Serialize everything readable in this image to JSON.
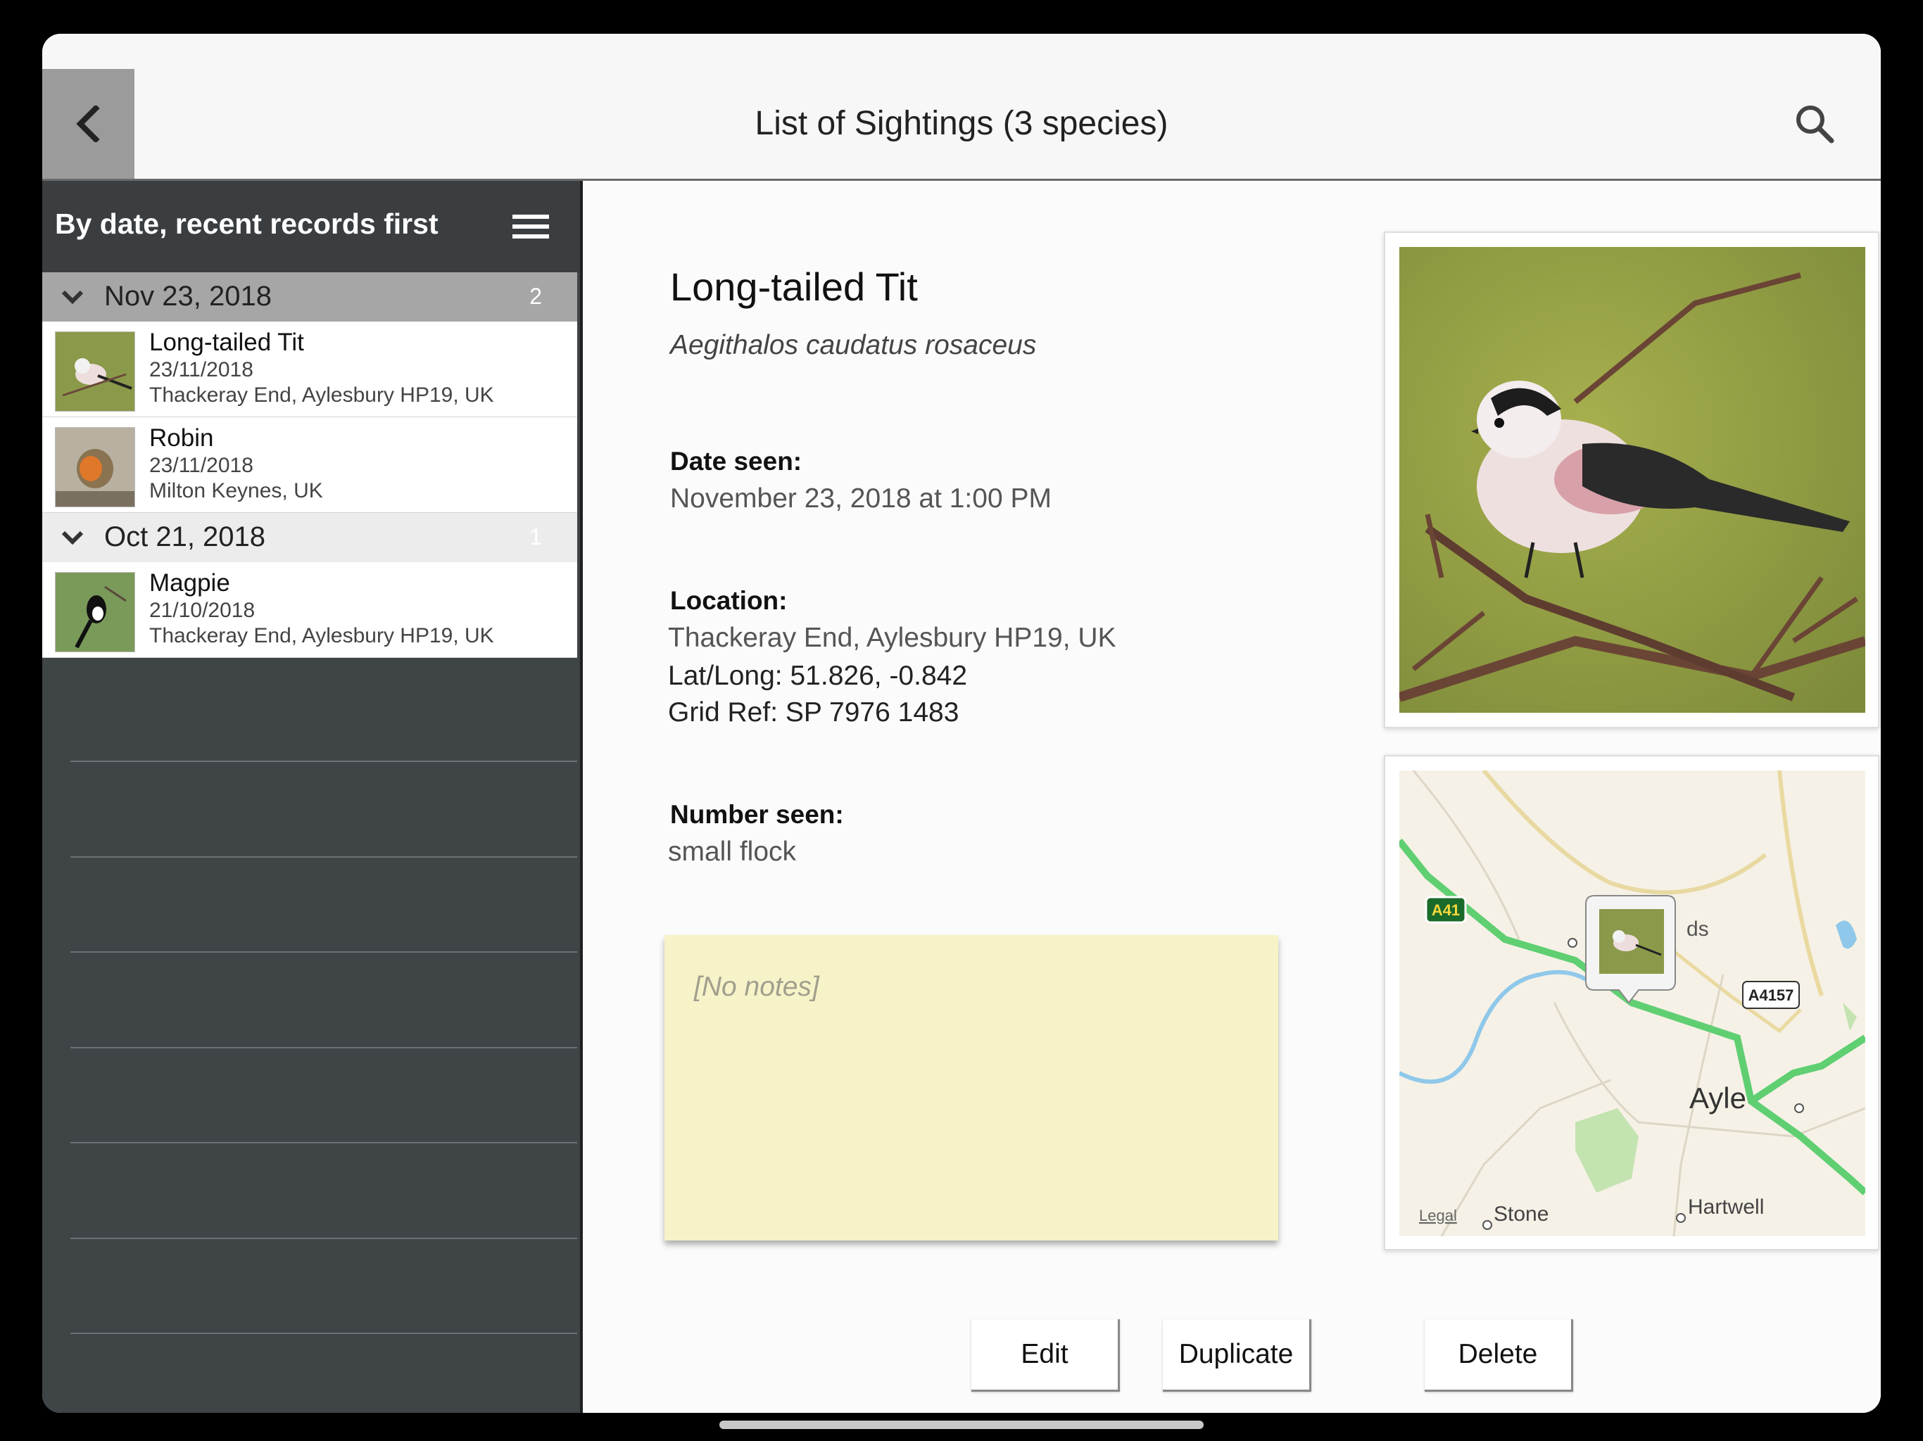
{
  "nav": {
    "title": "List of Sightings (3 species)",
    "back_icon": "chevron-left-icon",
    "search_icon": "search-icon"
  },
  "sidebar": {
    "sort_label": "By date, recent records first",
    "menu_icon": "hamburger-menu-icon",
    "groups": [
      {
        "label": "Nov 23, 2018",
        "count": "2",
        "items": [
          {
            "name": "Long-tailed Tit",
            "date": "23/11/2018",
            "location": "Thackeray End, Aylesbury HP19, UK"
          },
          {
            "name": "Robin",
            "date": "23/11/2018",
            "location": "Milton Keynes, UK"
          }
        ]
      },
      {
        "label": "Oct 21, 2018",
        "count": "1",
        "items": [
          {
            "name": "Magpie",
            "date": "21/10/2018",
            "location": "Thackeray End, Aylesbury HP19, UK"
          }
        ]
      }
    ]
  },
  "detail": {
    "name": "Long-tailed Tit",
    "latin": "Aegithalos caudatus rosaceus",
    "date_label": "Date seen:",
    "date_value": "November 23, 2018 at 1:00 PM",
    "location_label": "Location:",
    "location_value": "Thackeray End, Aylesbury HP19, UK",
    "latlong": "Lat/Long: 51.826, -0.842",
    "gridref": "Grid Ref: SP 7976 1483",
    "number_label": "Number seen:",
    "number_value": "small flock",
    "notes": "[No notes]"
  },
  "map": {
    "road1": "A41",
    "road2": "A4157",
    "place_stone": "Stone",
    "place_hartwell": "Hartwell",
    "place_ayle": "Ayle",
    "place_ds": "ds",
    "legal": "Legal"
  },
  "buttons": {
    "edit": "Edit",
    "duplicate": "Duplicate",
    "delete": "Delete"
  }
}
